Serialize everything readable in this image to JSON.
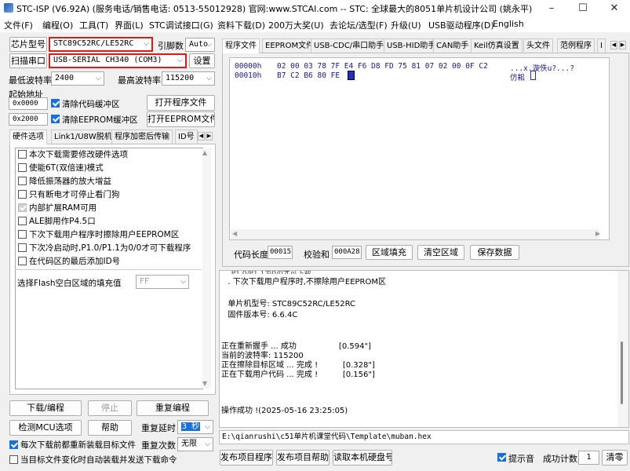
{
  "window": {
    "title": "STC-ISP (V6.92A) (服务电话/销售电话: 0513-55012928) 官网:www.STCAI.com  -- STC: 全球最大的8051单片机设计公司 (姚永平)",
    "controls": [
      "–",
      "☐",
      "✕"
    ]
  },
  "menu": [
    "文件(F)",
    "编程(O)",
    "工具(T)",
    "界面(L)",
    "STC调试接口(G)",
    "资料下载(D)",
    "200万大奖(U)",
    "去论坛/选型(F)",
    "升级(U)",
    "USB驱动程序(D)",
    "English"
  ],
  "left": {
    "chip_label": "芯片型号",
    "chip_value": "STC89C52RC/LE52RC",
    "pins_label": "引脚数",
    "pins_value": "Auto",
    "port_label": "扫描串口",
    "port_value": "USB-SERIAL CH340 (COM3)",
    "settings": "设置",
    "min_baud_label": "最低波特率",
    "min_baud": "2400",
    "max_baud_label": "最高波特率",
    "max_baud": "115200",
    "start_addr_label": "起始地址",
    "addr1": "0x0000",
    "clear_code": "清除代码缓冲区",
    "open_prog": "打开程序文件",
    "addr2": "0x2000",
    "clear_eeprom": "清除EEPROM缓冲区",
    "open_eeprom": "打开EEPROM文件",
    "tabs": [
      "硬件选项",
      "Link1/U8W脱机",
      "程序加密后传输",
      "ID号"
    ],
    "options": [
      "本次下载需要修改硬件选项",
      "使能6T(双倍速)模式",
      "降低振荡器的放大增益",
      "只有断电才可停止看门狗",
      "内部扩展RAM可用",
      "ALE脚用作P4.5口",
      "下次下载用户程序时擦除用户EEPROM区",
      "下次冷启动时,P1.0/P1.1为0/0才可下载程序",
      "在代码区的最后添加ID号"
    ],
    "fill_label": "选择Flash空白区域的填充值",
    "fill_value": "FF",
    "download": "下载/编程",
    "stop": "停止",
    "reprogram": "重复编程",
    "detect": "检测MCU选项",
    "help": "帮助",
    "repeat_delay_label": "重复延时",
    "repeat_delay": "3 秒",
    "repeat_count_label": "重复次数",
    "repeat_count": "无限",
    "reload_every": "每次下载前都重新装载目标文件",
    "auto_send": "当目标文件变化时自动装载并发送下载命令"
  },
  "right": {
    "tabs": [
      "程序文件",
      "EEPROM文件",
      "USB-CDC/串口助手",
      "USB-HID助手",
      "CAN助手",
      "Keil仿真设置",
      "头文件",
      "范例程序",
      "I"
    ],
    "hex_rows": [
      {
        "addr": "00000h",
        "bytes": "02 00 03 78 7F E4 F6 D8 FD 75 81 07 02 00 0F C2",
        "ascii": "...x.漩佚u?...?"
      },
      {
        "addr": "00010h",
        "bytes": "B7 C2 B6 80 FE",
        "ascii": "仿耜"
      }
    ],
    "code_len_label": "代码长度",
    "code_len": "00015",
    "checksum_label": "校验和",
    "checksum": "000A28",
    "fill_area": "区域填充",
    "clear_area": "清空区域",
    "save_data": "保存数据",
    "log_lines": [
      "  . 下次下载用户程序时,不擦除用户EEPROM区",
      "",
      "  单片机型号: STC89C52RC/LE52RC",
      "  固件版本号: 6.6.4C",
      "",
      "",
      "正在重新握手 ... 成功                 [0.594\"]",
      "当前的波特率: 115200",
      "正在擦除目标区域 ... 完成 !          [0.328\"]",
      "正在下载用户代码 ... 完成 !          [0.156\"]",
      "",
      "",
      "操作成功 !(2025-05-16 23:25:05)"
    ],
    "path": "E:\\qianrushi\\c51单片机课堂代码\\Template\\muban.hex",
    "publish_prog": "发布项目程序",
    "publish_help": "发布项目帮助",
    "read_disk": "读取本机硬盘号",
    "beep": "提示音",
    "success_label": "成功计数",
    "success_count": "1",
    "clear": "清零"
  }
}
